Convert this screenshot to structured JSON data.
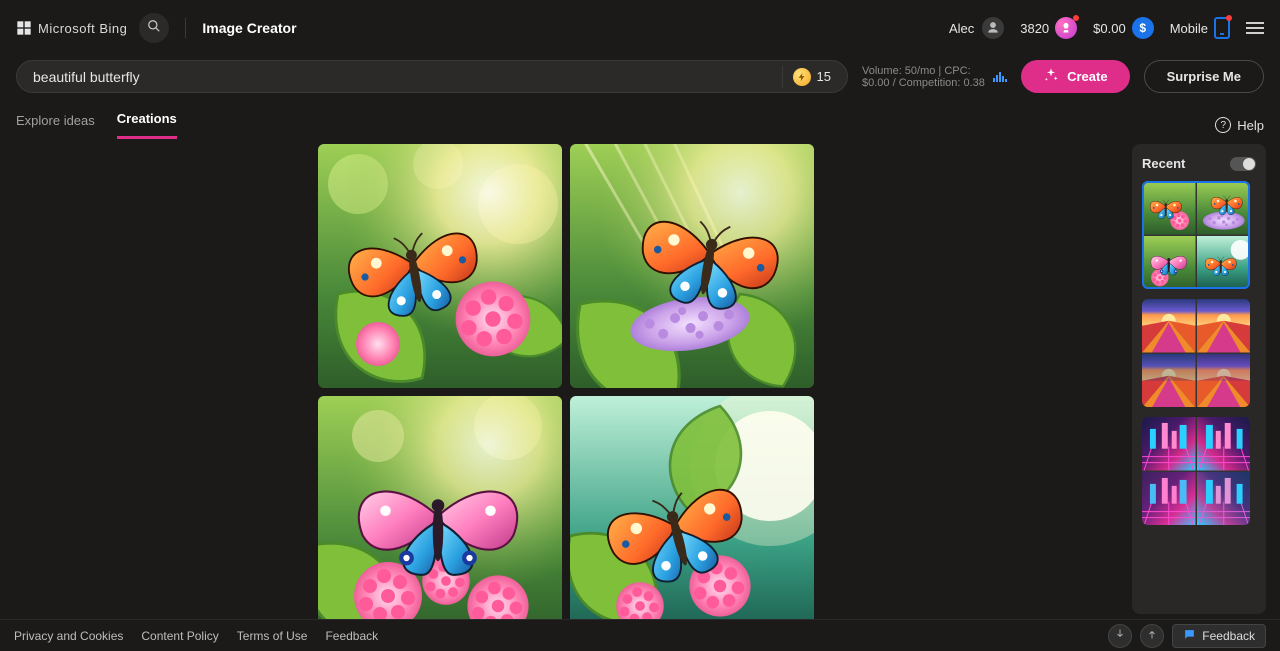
{
  "header": {
    "logo_text": "Microsoft Bing",
    "product": "Image Creator",
    "user_name": "Alec",
    "points": "3820",
    "money": "$0.00",
    "money_symbol": "$",
    "mobile_label": "Mobile"
  },
  "prompt": {
    "value": "beautiful butterfly",
    "boost_count": "15",
    "seo_hint": "Volume: 50/mo | CPC: $0.00 / Competition: 0.38"
  },
  "actions": {
    "create": "Create",
    "surprise": "Surprise Me"
  },
  "tabs": {
    "explore": "Explore ideas",
    "creations": "Creations",
    "help": "Help"
  },
  "recent": {
    "title": "Recent"
  },
  "footer": {
    "privacy": "Privacy and Cookies",
    "content_policy": "Content Policy",
    "terms": "Terms of Use",
    "feedback_link": "Feedback",
    "feedback_button": "Feedback"
  }
}
